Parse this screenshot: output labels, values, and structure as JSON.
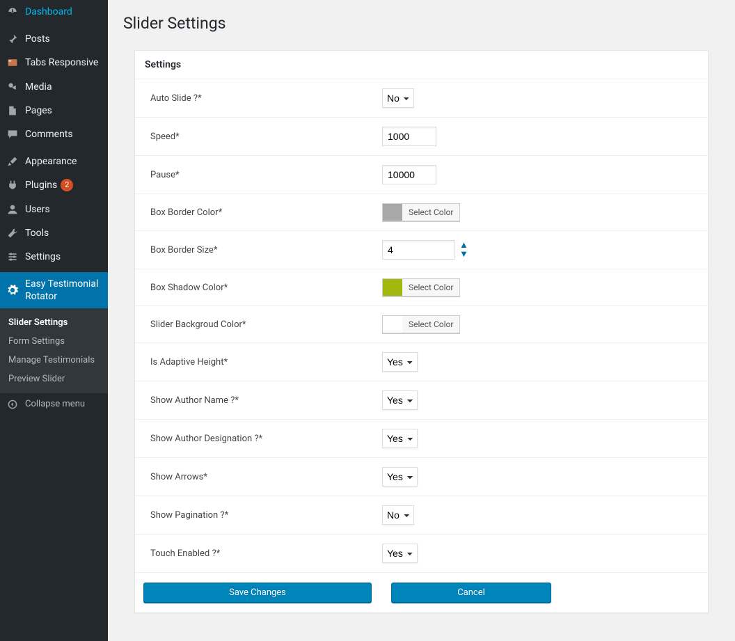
{
  "sidebar": {
    "items": [
      {
        "icon": "dashboard",
        "label": "Dashboard"
      },
      {
        "icon": "pin",
        "label": "Posts"
      },
      {
        "icon": "tabs",
        "label": "Tabs Responsive"
      },
      {
        "icon": "media",
        "label": "Media"
      },
      {
        "icon": "page",
        "label": "Pages"
      },
      {
        "icon": "comment",
        "label": "Comments"
      },
      {
        "icon": "brush",
        "label": "Appearance"
      },
      {
        "icon": "plugin",
        "label": "Plugins",
        "badge": "2"
      },
      {
        "icon": "user",
        "label": "Users"
      },
      {
        "icon": "wrench",
        "label": "Tools"
      },
      {
        "icon": "settings",
        "label": "Settings"
      },
      {
        "icon": "gear",
        "label": "Easy Testimonial Rotator",
        "active": true
      }
    ],
    "submenu": [
      {
        "label": "Slider Settings",
        "current": true
      },
      {
        "label": "Form Settings"
      },
      {
        "label": "Manage Testimonials"
      },
      {
        "label": "Preview Slider"
      }
    ],
    "collapse": "Collapse menu"
  },
  "page": {
    "title": "Slider Settings"
  },
  "panel": {
    "heading": "Settings",
    "rows": {
      "autoSlide": {
        "label": "Auto Slide ?*",
        "value": "No"
      },
      "speed": {
        "label": "Speed*",
        "value": "1000"
      },
      "pause": {
        "label": "Pause*",
        "value": "10000"
      },
      "boxBorderColor": {
        "label": "Box Border Color*",
        "swatch": "#a9a9a9",
        "btn": "Select Color"
      },
      "boxBorderSize": {
        "label": "Box Border Size*",
        "value": "4"
      },
      "boxShadowColor": {
        "label": "Box Shadow Color*",
        "swatch": "#a3b80e",
        "btn": "Select Color"
      },
      "sliderBg": {
        "label": "Slider Backgroud Color*",
        "swatch": "#ffffff",
        "btn": "Select Color"
      },
      "adaptive": {
        "label": "Is Adaptive Height*",
        "value": "Yes"
      },
      "authorName": {
        "label": "Show Author Name ?*",
        "value": "Yes"
      },
      "authorDesig": {
        "label": "Show Author Designation ?*",
        "value": "Yes"
      },
      "arrows": {
        "label": "Show Arrows*",
        "value": "Yes"
      },
      "pagination": {
        "label": "Show Pagination ?*",
        "value": "No"
      },
      "touch": {
        "label": "Touch Enabled ?*",
        "value": "Yes"
      }
    },
    "buttons": {
      "save": "Save Changes",
      "cancel": "Cancel"
    }
  }
}
